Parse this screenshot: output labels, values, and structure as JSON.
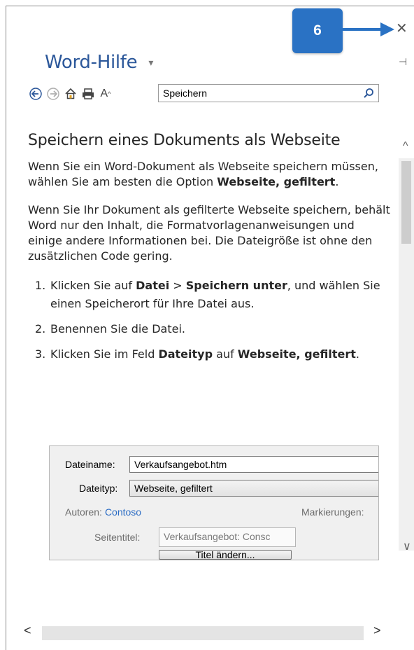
{
  "window": {
    "title": "Word-Hilfe",
    "callout_number": "6"
  },
  "icons": {
    "back": "back-arrow-icon",
    "forward": "forward-arrow-icon",
    "home": "home-icon",
    "print": "print-icon",
    "font_size": "font-size-icon",
    "font_size_glyph": "A",
    "search": "search-icon",
    "close": "close-icon",
    "pin": "pin-icon",
    "dropdown": "chevron-down-icon"
  },
  "search": {
    "value": "Speichern"
  },
  "article": {
    "title": "Speichern eines Dokuments als Webseite",
    "para1_text": "Wenn Sie ein Word-Dokument als Webseite speichern müssen, wählen Sie am besten die Option ",
    "para1_bold": "Webseite, gefiltert",
    "para1_end": ".",
    "para2": "Wenn Sie Ihr Dokument als gefilterte Webseite speichern, behält Word nur den Inhalt, die Formatvorlagenanweisungen und einige andere Informationen bei. Die Dateigröße ist ohne den zusätzlichen Code gering.",
    "steps": [
      {
        "num": "1.",
        "t1": "Klicken Sie auf ",
        "b1": "Datei",
        "t2": " > ",
        "b2": "Speichern unter",
        "t3": ", und wählen Sie einen Speicherort für Ihre Datei aus."
      },
      {
        "num": "2.",
        "t1": "Benennen Sie die Datei."
      },
      {
        "num": "3.",
        "t1": "Klicken Sie im Feld ",
        "b1": "Dateityp",
        "t2": " auf ",
        "b2": "Webseite, gefiltert",
        "t3": "."
      }
    ]
  },
  "dialog": {
    "filename_label": "Dateiname:",
    "filename_value": "Verkaufsangebot.htm",
    "filetype_label": "Dateityp:",
    "filetype_value": "Webseite, gefiltert",
    "authors_label": "Autoren:",
    "authors_value": "Contoso",
    "tags_label": "Markierungen:",
    "page_title_label": "Seitentitel:",
    "page_title_value": "Verkaufsangebot: Consc",
    "change_title_button": "Titel ändern..."
  },
  "colors": {
    "accent": "#2b579a",
    "callout": "#2a72c4",
    "link": "#2b6cc4"
  }
}
